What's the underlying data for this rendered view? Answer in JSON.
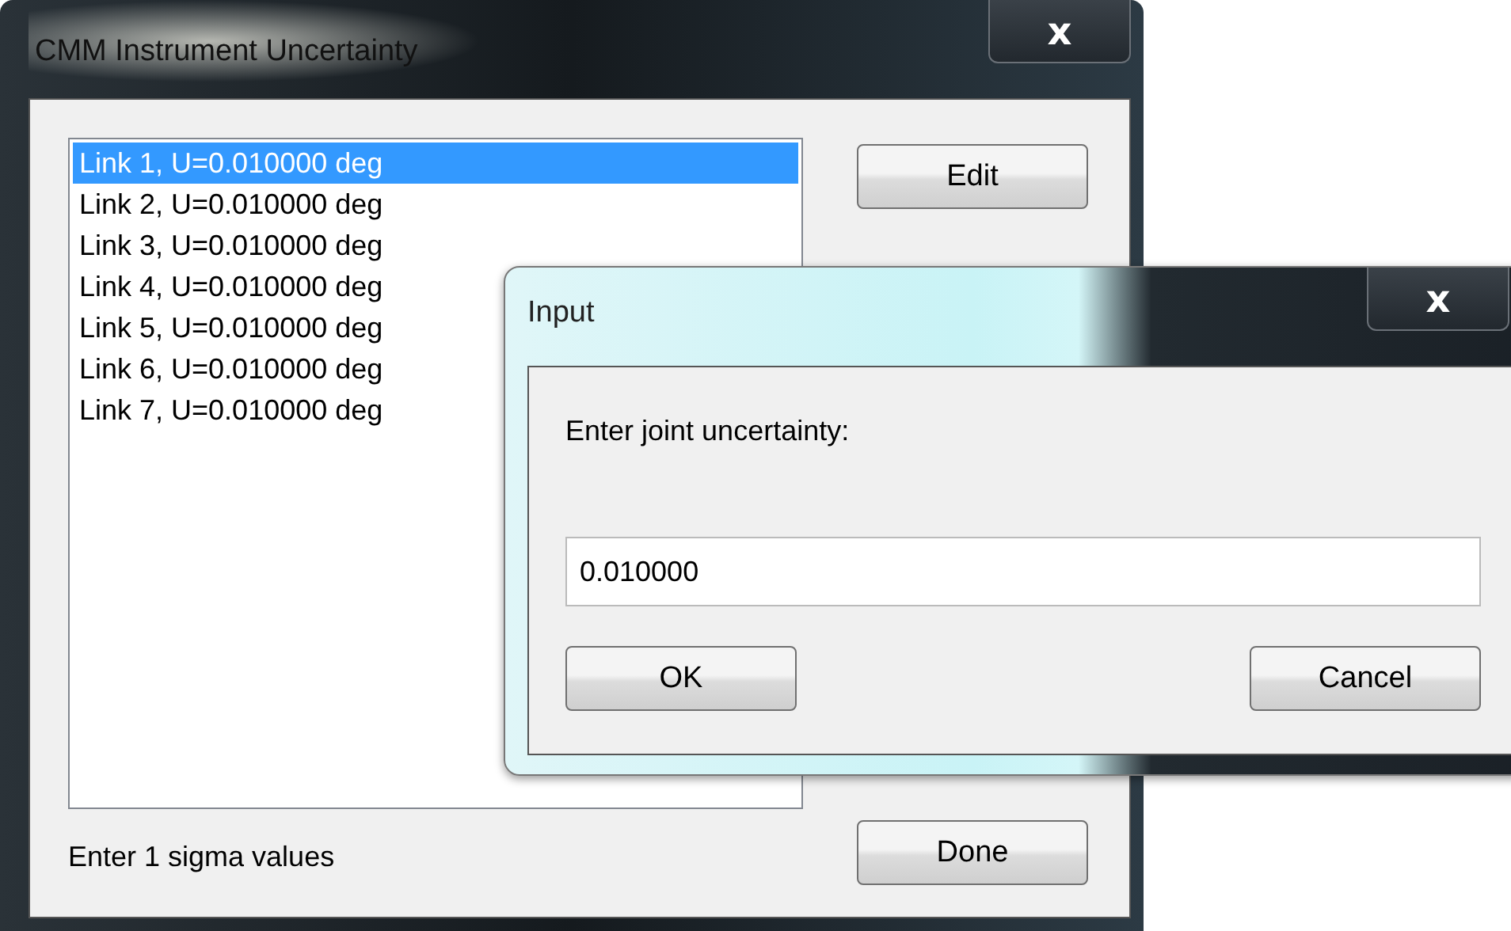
{
  "main_window": {
    "title": "CMM Instrument Uncertainty",
    "close_label": "x",
    "list": [
      {
        "label": "Link 1, U=0.010000 deg",
        "selected": true
      },
      {
        "label": "Link 2, U=0.010000 deg",
        "selected": false
      },
      {
        "label": "Link 3, U=0.010000 deg",
        "selected": false
      },
      {
        "label": "Link 4, U=0.010000 deg",
        "selected": false
      },
      {
        "label": "Link 5, U=0.010000 deg",
        "selected": false
      },
      {
        "label": "Link 6, U=0.010000 deg",
        "selected": false
      },
      {
        "label": "Link 7, U=0.010000 deg",
        "selected": false
      }
    ],
    "edit_button": "Edit",
    "done_button": "Done",
    "status": "Enter 1 sigma values"
  },
  "input_dialog": {
    "title": "Input",
    "close_label": "x",
    "prompt": "Enter joint uncertainty:",
    "value": "0.010000",
    "ok_button": "OK",
    "cancel_button": "Cancel"
  }
}
